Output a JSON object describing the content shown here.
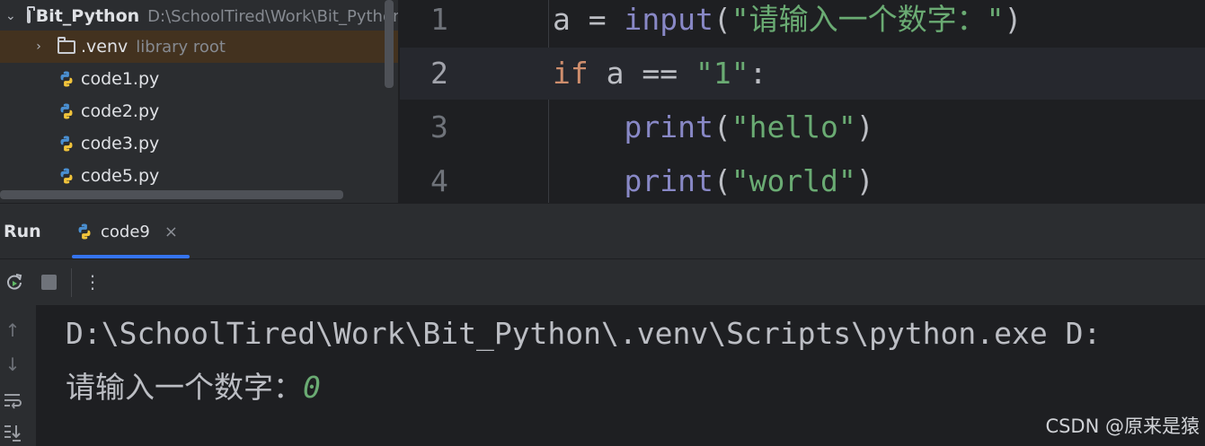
{
  "project_tree": {
    "root": {
      "name": "Bit_Python",
      "path": "D:\\SchoolTired\\Work\\Bit_Python"
    },
    "venv": {
      "name": ".venv",
      "hint": "library root"
    },
    "files": [
      "code1.py",
      "code2.py",
      "code3.py",
      "code5.py"
    ]
  },
  "editor": {
    "lines": [
      {
        "number": "1",
        "tokens": [
          {
            "t": "a = ",
            "c": "plain"
          },
          {
            "t": "input",
            "c": "fn"
          },
          {
            "t": "(",
            "c": "plain"
          },
          {
            "t": "\"请输入一个数字：\"",
            "c": "str"
          },
          {
            "t": ")",
            "c": "plain"
          }
        ]
      },
      {
        "number": "2",
        "tokens": [
          {
            "t": "if",
            "c": "kw"
          },
          {
            "t": " a == ",
            "c": "plain"
          },
          {
            "t": "\"1\"",
            "c": "str"
          },
          {
            "t": ":",
            "c": "plain"
          }
        ]
      },
      {
        "number": "3",
        "tokens": [
          {
            "t": "    ",
            "c": "plain"
          },
          {
            "t": "print",
            "c": "fn"
          },
          {
            "t": "(",
            "c": "plain"
          },
          {
            "t": "\"hello\"",
            "c": "str"
          },
          {
            "t": ")",
            "c": "plain"
          }
        ]
      },
      {
        "number": "4",
        "tokens": [
          {
            "t": "    ",
            "c": "plain"
          },
          {
            "t": "print",
            "c": "fn"
          },
          {
            "t": "(",
            "c": "plain"
          },
          {
            "t": "\"world\"",
            "c": "str"
          },
          {
            "t": ")",
            "c": "plain"
          }
        ]
      }
    ]
  },
  "run": {
    "title": "Run",
    "tab_label": "code9",
    "tab_close": "×",
    "more_label": "⋮"
  },
  "console": {
    "command": "D:\\SchoolTired\\Work\\Bit_Python\\.venv\\Scripts\\python.exe D:",
    "prompt": "请输入一个数字：",
    "user_input": "0"
  },
  "watermark": "CSDN @原来是猿",
  "colors": {
    "keyword": "#cf8e6d",
    "builtin": "#8888c6",
    "string": "#6aab73",
    "accent": "#3574f0"
  }
}
